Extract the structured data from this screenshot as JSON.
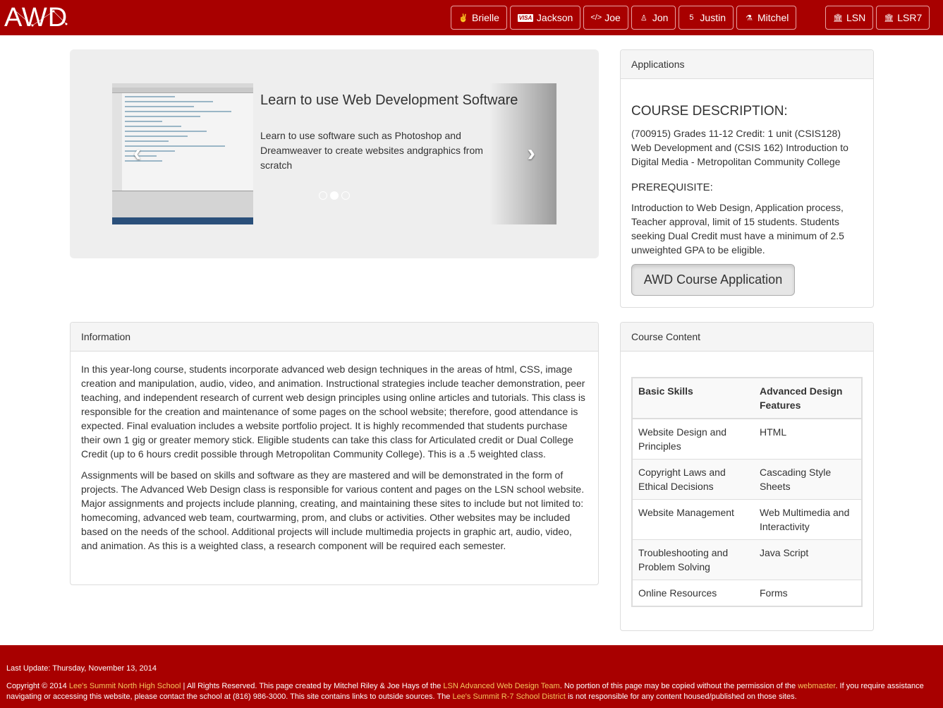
{
  "brand": "AWD",
  "nav": {
    "people": [
      {
        "label": "Brielle",
        "icon": "hand-peace-icon",
        "glyph": "✌"
      },
      {
        "label": "Jackson",
        "icon": "visa-card-icon",
        "glyph": "VISA"
      },
      {
        "label": "Joe",
        "icon": "code-icon",
        "glyph": "</>"
      },
      {
        "label": "Jon",
        "icon": "linux-tux-icon",
        "glyph": "♙"
      },
      {
        "label": "Justin",
        "icon": "html5-icon",
        "glyph": "5"
      },
      {
        "label": "Mitchel",
        "icon": "gamepad-icon",
        "glyph": "⚗"
      }
    ],
    "schools": [
      {
        "label": "LSN",
        "icon": "institution-icon",
        "glyph": "🏛"
      },
      {
        "label": "LSR7",
        "icon": "institution-icon",
        "glyph": "🏛"
      }
    ]
  },
  "carousel": {
    "title": "Learn to use Web Development Software",
    "text": "Learn to use software such as Photoshop and Dreamweaver to create websites andgraphics from scratch",
    "prev_glyph": "‹",
    "next_glyph": "›",
    "slides": 3,
    "active_slide": 2
  },
  "applications": {
    "heading": "Applications",
    "course_title": "COURSE DESCRIPTION:",
    "course_text": "(700915) Grades 11-12 Credit: 1 unit (CSIS128) Web Development and (CSIS 162) Introduction to Digital Media - Metropolitan Community College",
    "prereq_title": "PREREQUISITE:",
    "prereq_text": "Introduction to Web Design, Application process, Teacher approval, limit of 15 students. Students seeking Dual Credit must have a minimum of 2.5 unweighted GPA to be eligible.",
    "button": "AWD Course Application"
  },
  "information": {
    "heading": "Information",
    "para1": "In this year-long course, students incorporate advanced web design techniques in the areas of html, CSS, image creation and manipulation, audio, video, and animation. Instructional strategies include teacher demonstration, peer teaching, and independent research of current web design principles using online articles and tutorials. This class is responsible for the creation and maintenance of some pages on the school website; therefore, good attendance is expected. Final evaluation includes a website portfolio project. It is highly recommended that students purchase their own 1 gig or greater memory stick. Eligible students can take this class for Articulated credit or Dual College Credit (up to 6 hours credit possible through Metropolitan Community College). This is a .5 weighted class.",
    "para2": "Assignments will be based on skills and software as they are mastered and will be demonstrated in the form of projects. The Advanced Web Design class is responsible for various content and pages on the LSN school website. Major assignments and projects include planning, creating, and maintaining these sites to include but not limited to: homecoming, advanced web team, courtwarming, prom, and clubs or activities. Other websites may be included based on the needs of the school. Additional projects will include multimedia projects in graphic art, audio, video, and animation. As this is a weighted class, a research component will be required each semester."
  },
  "course_content": {
    "heading": "Course Content",
    "columns": [
      "Basic Skills",
      "Advanced Design Features"
    ],
    "rows": [
      [
        "Website Design and Principles",
        "HTML"
      ],
      [
        "Copyright Laws and Ethical Decisions",
        "Cascading Style Sheets"
      ],
      [
        "Website Management",
        "Web Multimedia and Interactivity"
      ],
      [
        "Troubleshooting and Problem Solving",
        "Java Script"
      ],
      [
        "Online Resources",
        "Forms"
      ]
    ]
  },
  "footer": {
    "last_update": "Last Update: Thursday, November 13, 2014",
    "c1": "Copyright © 2014 ",
    "link1": "Lee's Summit North High School",
    "c2": " | All Rights Reserved. This page created by Mitchel Riley & Joe Hays of the ",
    "link2": "LSN Advanced Web Design Team",
    "c3": ". No portion of this page may be copied without the permission of the ",
    "link3": "webmaster",
    "c4": ". If you require assistance navigating or accessing this website, please contact the school at (816) 986-3000. This site contains links to outside sources. The ",
    "link4": "Lee's Summit R-7 School District",
    "c5": " is not responsible for any content housed/published on those sites."
  },
  "colors": {
    "brand_red": "#a80000",
    "footer_link": "#f5c45c"
  }
}
